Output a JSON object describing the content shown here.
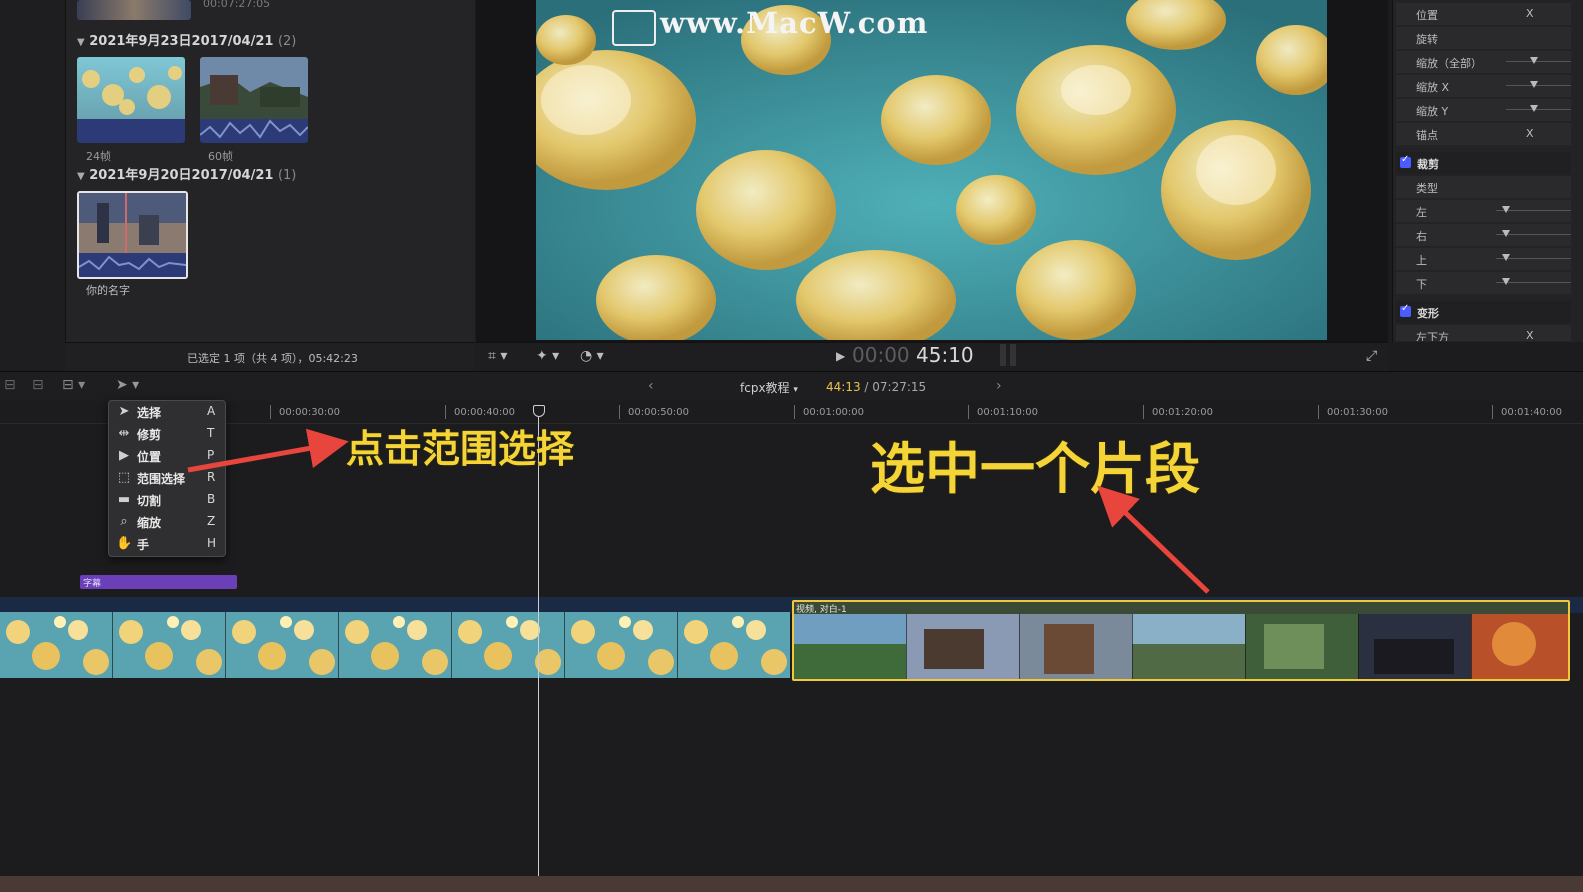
{
  "browser": {
    "top_clip_timecode": "00:07:27:05",
    "groups": [
      {
        "date": "2021年9月23日2017/04/21",
        "count": "(2)"
      },
      {
        "date": "2021年9月20日2017/04/21",
        "count": "(1)"
      }
    ],
    "clips": [
      {
        "label": "24帧"
      },
      {
        "label": "60帧"
      },
      {
        "label": "你的名字"
      }
    ],
    "status": "已选定 1 项（共 4 项），05:42:23"
  },
  "viewer": {
    "watermark": "www.MacW.com",
    "timecode_dim": "00:00",
    "timecode_bright": "45:10"
  },
  "inspector": {
    "rows_top": [
      {
        "label": "位置",
        "value": "X"
      },
      {
        "label": "旋转",
        "value": ""
      },
      {
        "label": "缩放（全部）",
        "value": ""
      },
      {
        "label": "缩放 X",
        "value": ""
      },
      {
        "label": "缩放 Y",
        "value": ""
      },
      {
        "label": "锚点",
        "value": "X"
      }
    ],
    "crop_section": "裁剪",
    "crop_rows": [
      {
        "label": "类型"
      },
      {
        "label": "左"
      },
      {
        "label": "右"
      },
      {
        "label": "上"
      },
      {
        "label": "下"
      }
    ],
    "distort_section": "变形",
    "distort_rows": [
      {
        "label": "左下方",
        "value": "X"
      }
    ]
  },
  "timeline": {
    "project_name": "fcpx教程",
    "current_tc": "44:13",
    "total_tc": "/ 07:27:15",
    "ruler": [
      "00:00:30:00",
      "00:00:40:00",
      "00:00:50:00",
      "00:01:00:00",
      "00:01:10:00",
      "00:01:20:00",
      "00:01:30:00",
      "00:01:40:00"
    ],
    "caption_clip": "字幕",
    "selected_clip_title": "视频, 对白-1"
  },
  "tools_menu": [
    {
      "icon": "arrow-select-icon",
      "glyph": "➤",
      "name": "选择",
      "key": "A"
    },
    {
      "icon": "trim-icon",
      "glyph": "⇹",
      "name": "修剪",
      "key": "T"
    },
    {
      "icon": "position-icon",
      "glyph": "▶",
      "name": "位置",
      "key": "P"
    },
    {
      "icon": "range-select-icon",
      "glyph": "⬚",
      "name": "范围选择",
      "key": "R"
    },
    {
      "icon": "blade-icon",
      "glyph": "▬",
      "name": "切割",
      "key": "B"
    },
    {
      "icon": "zoom-icon",
      "glyph": "⌕",
      "name": "缩放",
      "key": "Z"
    },
    {
      "icon": "hand-icon",
      "glyph": "✋",
      "name": "手",
      "key": "H"
    }
  ],
  "annotations": {
    "left": "点击范围选择",
    "right": "选中一个片段",
    "color": "#f4d437",
    "arrow_color": "#e8453c"
  },
  "colors": {
    "selection_outline": "#f0c93a",
    "caption_purple": "#6a3fb8",
    "timecode_yellow": "#e9c24b"
  }
}
